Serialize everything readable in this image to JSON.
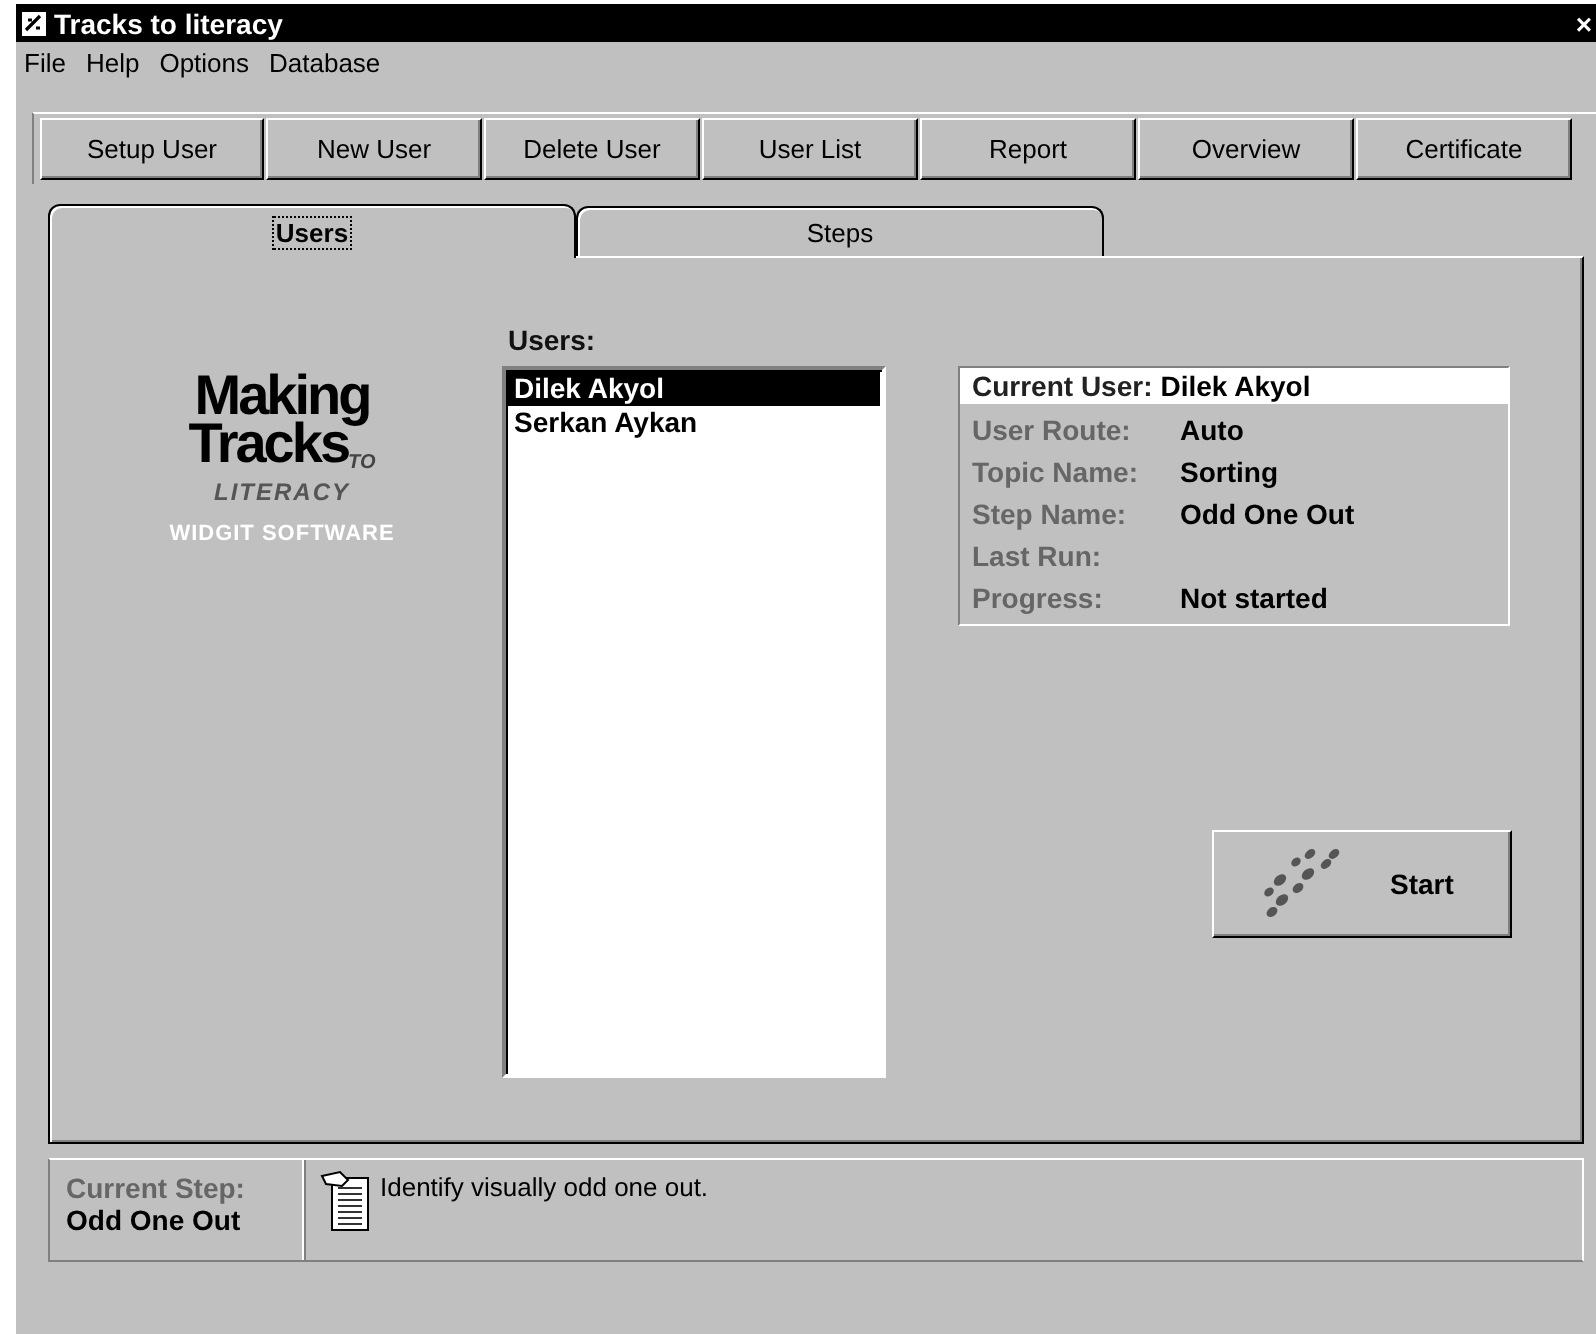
{
  "window": {
    "title": "Tracks to literacy",
    "close": "×"
  },
  "menu": [
    {
      "label": "File"
    },
    {
      "label": "Help"
    },
    {
      "label": "Options"
    },
    {
      "label": "Database"
    }
  ],
  "toolbar": [
    {
      "label": "Setup User"
    },
    {
      "label": "New User"
    },
    {
      "label": "Delete User"
    },
    {
      "label": "User List"
    },
    {
      "label": "Report"
    },
    {
      "label": "Overview"
    },
    {
      "label": "Certificate"
    }
  ],
  "tabs": [
    {
      "label": "Users",
      "selected": true
    },
    {
      "label": "Steps",
      "selected": false
    }
  ],
  "logo": {
    "line_1": "Making",
    "line_2": "Tracks",
    "to": "TO",
    "line_3": "LITERACY",
    "publisher": "WIDGIT SOFTWARE"
  },
  "users": {
    "label": "Users:",
    "items": [
      {
        "name": "Dilek Akyol",
        "selected": true
      },
      {
        "name": "Serkan Aykan",
        "selected": false
      }
    ]
  },
  "details": {
    "current_user_label": "Current User:",
    "current_user": "Dilek Akyol",
    "fields": [
      {
        "label": "User Route:",
        "value": "Auto"
      },
      {
        "label": "Topic Name:",
        "value": "Sorting"
      },
      {
        "label": "Step Name:",
        "value": "Odd One Out"
      },
      {
        "label": "Last Run:"
      },
      {
        "label": "Progress:",
        "value": "Not started"
      }
    ]
  },
  "start_button": {
    "label": "Start"
  },
  "status": {
    "current_step_label": "Current Step:",
    "current_step": "Odd One Out",
    "description": "Identify visually odd one out."
  }
}
